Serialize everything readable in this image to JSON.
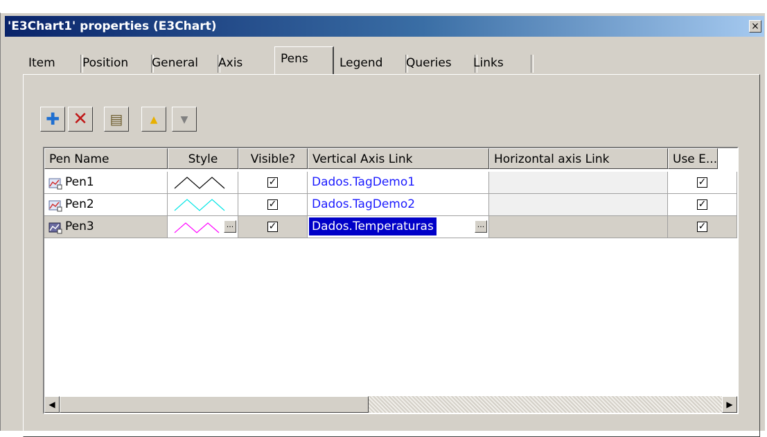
{
  "window": {
    "title": "'E3Chart1' properties (E3Chart)",
    "close_glyph": "×"
  },
  "tabs": [
    {
      "label": "Item"
    },
    {
      "label": "Position"
    },
    {
      "label": "General"
    },
    {
      "label": "Axis"
    },
    {
      "label": "Pens",
      "active": true
    },
    {
      "label": "Legend"
    },
    {
      "label": "Queries"
    },
    {
      "label": "Links"
    }
  ],
  "toolbar": {
    "buttons": [
      {
        "name": "add-pen-button",
        "icon": "plus-icon",
        "glyph": "✚",
        "color": "#1f6fd0"
      },
      {
        "name": "delete-pen-button",
        "icon": "delete-x-icon",
        "glyph": "✕",
        "color": "#c01818"
      },
      {
        "name": "pen-properties-button",
        "icon": "properties-icon",
        "glyph": "▤",
        "color": "#6b5a2a"
      },
      {
        "name": "move-up-button",
        "icon": "arrow-up-icon",
        "glyph": "▲",
        "color": "#e8b000"
      },
      {
        "name": "move-down-button",
        "icon": "arrow-down-icon",
        "glyph": "▼",
        "color": "#808080"
      }
    ]
  },
  "grid": {
    "columns": [
      "Pen Name",
      "Style",
      "Visible?",
      "Vertical Axis Link",
      "Horizontal axis Link",
      "Use E..."
    ],
    "rows": [
      {
        "name": "Pen1",
        "style_color": "#000000",
        "visible": "✓",
        "vertical_link": "Dados.TagDemo1",
        "horizontal_link": "",
        "use_e": "✓",
        "selected": false
      },
      {
        "name": "Pen2",
        "style_color": "#00e5e5",
        "visible": "✓",
        "vertical_link": "Dados.TagDemo2",
        "horizontal_link": "",
        "use_e": "✓",
        "selected": false
      },
      {
        "name": "Pen3",
        "style_color": "#ff00ff",
        "visible": "✓",
        "vertical_link": "Dados.Temperaturas",
        "horizontal_link": "",
        "use_e": "✓",
        "selected": true
      }
    ],
    "ellipsis_glyph": "...",
    "scroll_left_glyph": "◀",
    "scroll_right_glyph": "▶"
  },
  "colors": {
    "title_gradient_start": "#0a246a",
    "selection": "#0000c8",
    "link_text": "#1a1aff",
    "dialog_face": "#d4d0c8"
  }
}
